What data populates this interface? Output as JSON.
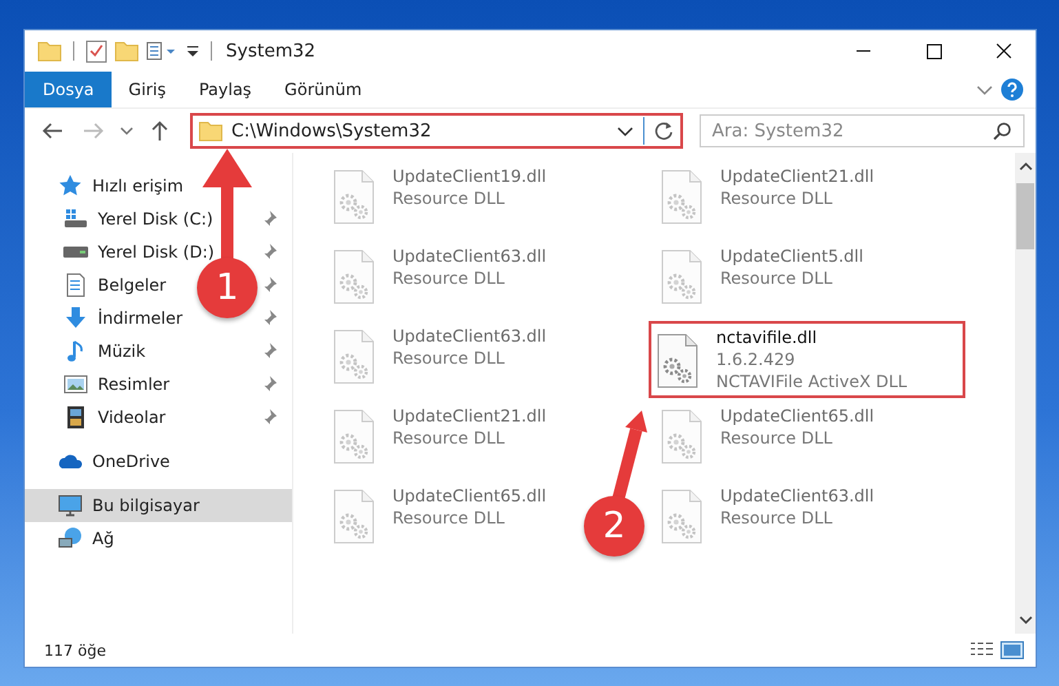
{
  "window": {
    "title": "System32"
  },
  "ribbon_tabs": [
    {
      "label": "Dosya",
      "selected": true
    },
    {
      "label": "Giriş",
      "selected": false
    },
    {
      "label": "Paylaş",
      "selected": false
    },
    {
      "label": "Görünüm",
      "selected": false
    }
  ],
  "address": {
    "path": "C:\\Windows\\System32",
    "highlighted": true
  },
  "search": {
    "placeholder": "Ara: System32"
  },
  "sidebar": {
    "items": [
      {
        "label": "Hızlı erişim",
        "kind": "star",
        "selected": false,
        "children": [
          {
            "label": "Yerel Disk (C:)",
            "kind": "drive-c",
            "pinned": true
          },
          {
            "label": "Yerel Disk (D:)",
            "kind": "drive",
            "pinned": true
          },
          {
            "label": "Belgeler",
            "kind": "document",
            "pinned": true
          },
          {
            "label": "İndirmeler",
            "kind": "download",
            "pinned": true
          },
          {
            "label": "Müzik",
            "kind": "music",
            "pinned": true
          },
          {
            "label": "Resimler",
            "kind": "pictures",
            "pinned": true
          },
          {
            "label": "Videolar",
            "kind": "video",
            "pinned": true
          }
        ]
      },
      {
        "label": "OneDrive",
        "kind": "cloud",
        "selected": false
      },
      {
        "label": "Bu bilgisayar",
        "kind": "computer",
        "selected": true
      },
      {
        "label": "Ağ",
        "kind": "network",
        "selected": false
      }
    ]
  },
  "files": [
    {
      "name": "UpdateClient19.dll",
      "description": "Resource DLL",
      "blurred": true,
      "highlighted": false
    },
    {
      "name": "UpdateClient21.dll",
      "description": "Resource DLL",
      "blurred": true,
      "highlighted": false
    },
    {
      "name": "UpdateClient63.dll",
      "description": "Resource DLL",
      "blurred": true,
      "highlighted": false
    },
    {
      "name": "UpdateClient5.dll",
      "description": "Resource DLL",
      "blurred": true,
      "highlighted": false
    },
    {
      "name": "UpdateClient63.dll",
      "description": "Resource DLL",
      "blurred": true,
      "highlighted": false
    },
    {
      "name": "nctavifile.dll",
      "version": "1.6.2.429",
      "description": "NCTAVIFile ActiveX DLL",
      "blurred": false,
      "highlighted": true
    },
    {
      "name": "UpdateClient21.dll",
      "description": "Resource DLL",
      "blurred": true,
      "highlighted": false
    },
    {
      "name": "UpdateClient65.dll",
      "description": "Resource DLL",
      "blurred": true,
      "highlighted": false
    },
    {
      "name": "UpdateClient65.dll",
      "description": "Resource DLL",
      "blurred": true,
      "highlighted": false
    },
    {
      "name": "UpdateClient63.dll",
      "description": "Resource DLL",
      "blurred": true,
      "highlighted": false
    }
  ],
  "status_bar": {
    "item_count": "117 öğe"
  },
  "annotations": [
    {
      "label": "1"
    },
    {
      "label": "2"
    }
  ]
}
